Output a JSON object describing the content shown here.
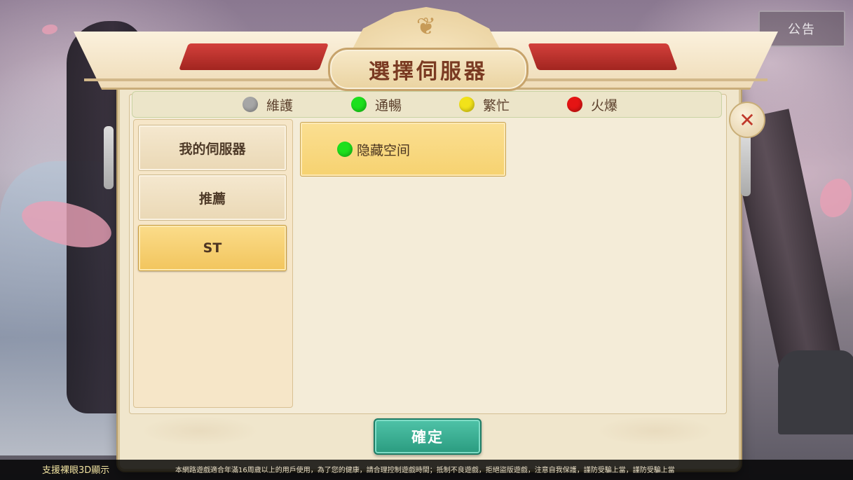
{
  "top_bar": {
    "notice_label": "公告"
  },
  "dialog": {
    "title": "選擇伺服器"
  },
  "legend": [
    {
      "label": "維護",
      "color": "#a6a6a6"
    },
    {
      "label": "通暢",
      "color": "#1de01d"
    },
    {
      "label": "繁忙",
      "color": "#f2e21a"
    },
    {
      "label": "火爆",
      "color": "#e51414"
    }
  ],
  "categories": [
    {
      "label": "我的伺服器",
      "active": false
    },
    {
      "label": "推薦",
      "active": false
    },
    {
      "label": "ST",
      "active": true
    }
  ],
  "servers": [
    {
      "name": "隐藏空间",
      "status_color": "#1de01d"
    }
  ],
  "confirm_label": "確定",
  "close_icon": "close-x-icon",
  "footer": {
    "left_label": "支援裸眼3D顯示",
    "notice": "本網路遊戲適合年滿16周歲以上的用戶使用，為了您的健康，請合理控制遊戲時間；抵制不良遊戲，拒絕盜版遊戲，注意自我保護，謹防受騙上當，謹防受騙上當"
  }
}
